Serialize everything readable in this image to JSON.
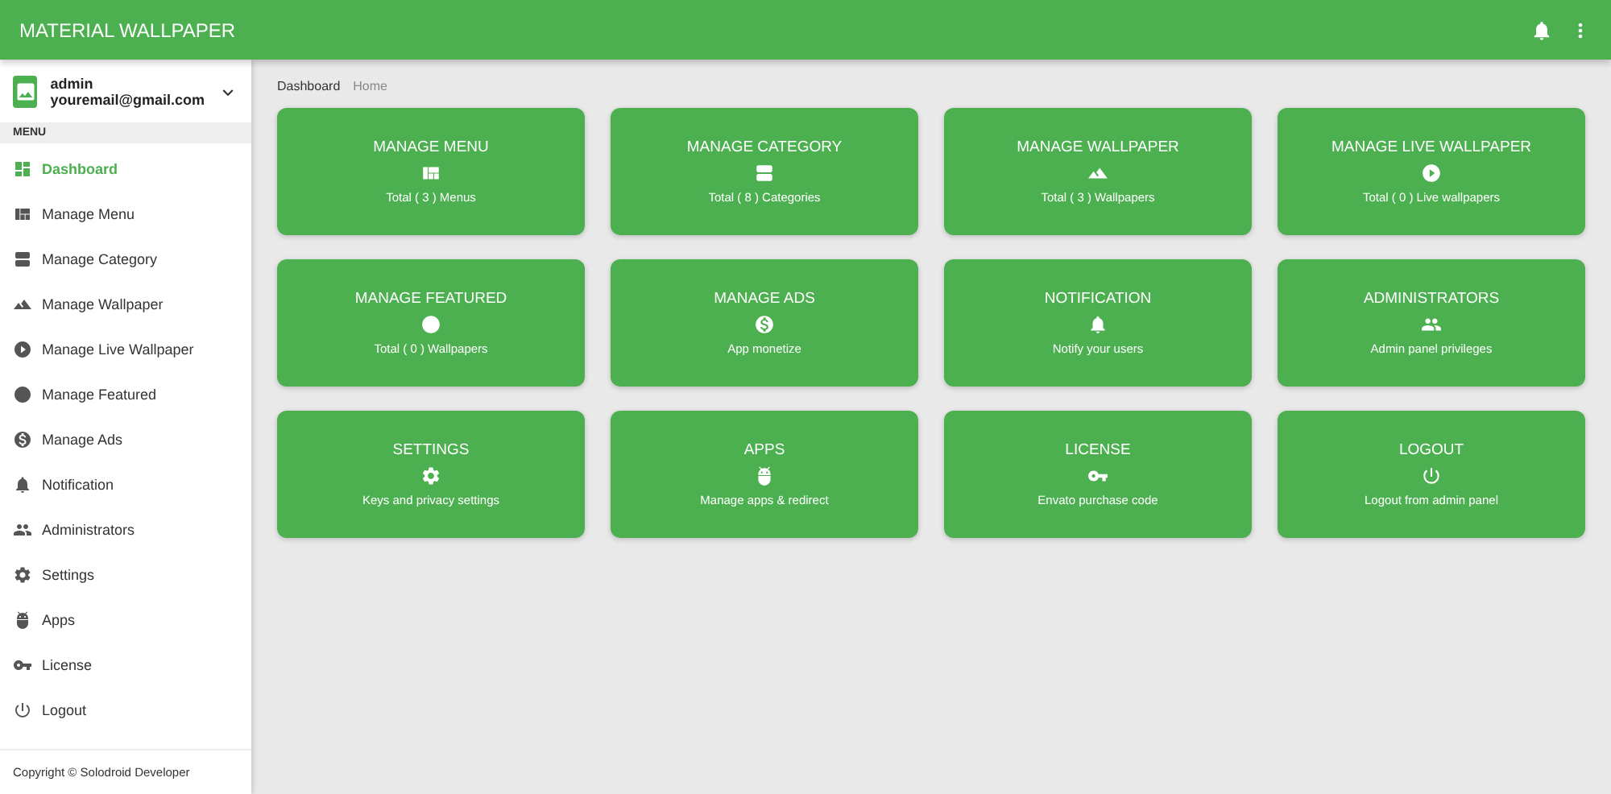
{
  "header": {
    "title": "MATERIAL WALLPAPER"
  },
  "profile": {
    "name": "admin",
    "email": "youremail@gmail.com"
  },
  "sidebar": {
    "section": "MENU",
    "items": [
      {
        "label": "Dashboard",
        "selected": true
      },
      {
        "label": "Manage Menu",
        "selected": false
      },
      {
        "label": "Manage Category",
        "selected": false
      },
      {
        "label": "Manage Wallpaper",
        "selected": false
      },
      {
        "label": "Manage Live Wallpaper",
        "selected": false
      },
      {
        "label": "Manage Featured",
        "selected": false
      },
      {
        "label": "Manage Ads",
        "selected": false
      },
      {
        "label": "Notification",
        "selected": false
      },
      {
        "label": "Administrators",
        "selected": false
      },
      {
        "label": "Settings",
        "selected": false
      },
      {
        "label": "Apps",
        "selected": false
      },
      {
        "label": "License",
        "selected": false
      },
      {
        "label": "Logout",
        "selected": false
      }
    ],
    "footer": "Copyright © Solodroid Developer"
  },
  "breadcrumb": [
    "Dashboard",
    "Home"
  ],
  "cards": [
    {
      "title": "MANAGE MENU",
      "subtitle": "Total ( 3 ) Menus"
    },
    {
      "title": "MANAGE CATEGORY",
      "subtitle": "Total ( 8 ) Categories"
    },
    {
      "title": "MANAGE WALLPAPER",
      "subtitle": "Total ( 3 ) Wallpapers"
    },
    {
      "title": "MANAGE LIVE WALLPAPER",
      "subtitle": "Total ( 0 ) Live wallpapers"
    },
    {
      "title": "MANAGE FEATURED",
      "subtitle": "Total ( 0 ) Wallpapers"
    },
    {
      "title": "MANAGE ADS",
      "subtitle": "App monetize"
    },
    {
      "title": "NOTIFICATION",
      "subtitle": "Notify your users"
    },
    {
      "title": "ADMINISTRATORS",
      "subtitle": "Admin panel privileges"
    },
    {
      "title": "SETTINGS",
      "subtitle": "Keys and privacy settings"
    },
    {
      "title": "APPS",
      "subtitle": "Manage apps & redirect"
    },
    {
      "title": "LICENSE",
      "subtitle": "Envato purchase code"
    },
    {
      "title": "LOGOUT",
      "subtitle": "Logout from admin panel"
    }
  ]
}
